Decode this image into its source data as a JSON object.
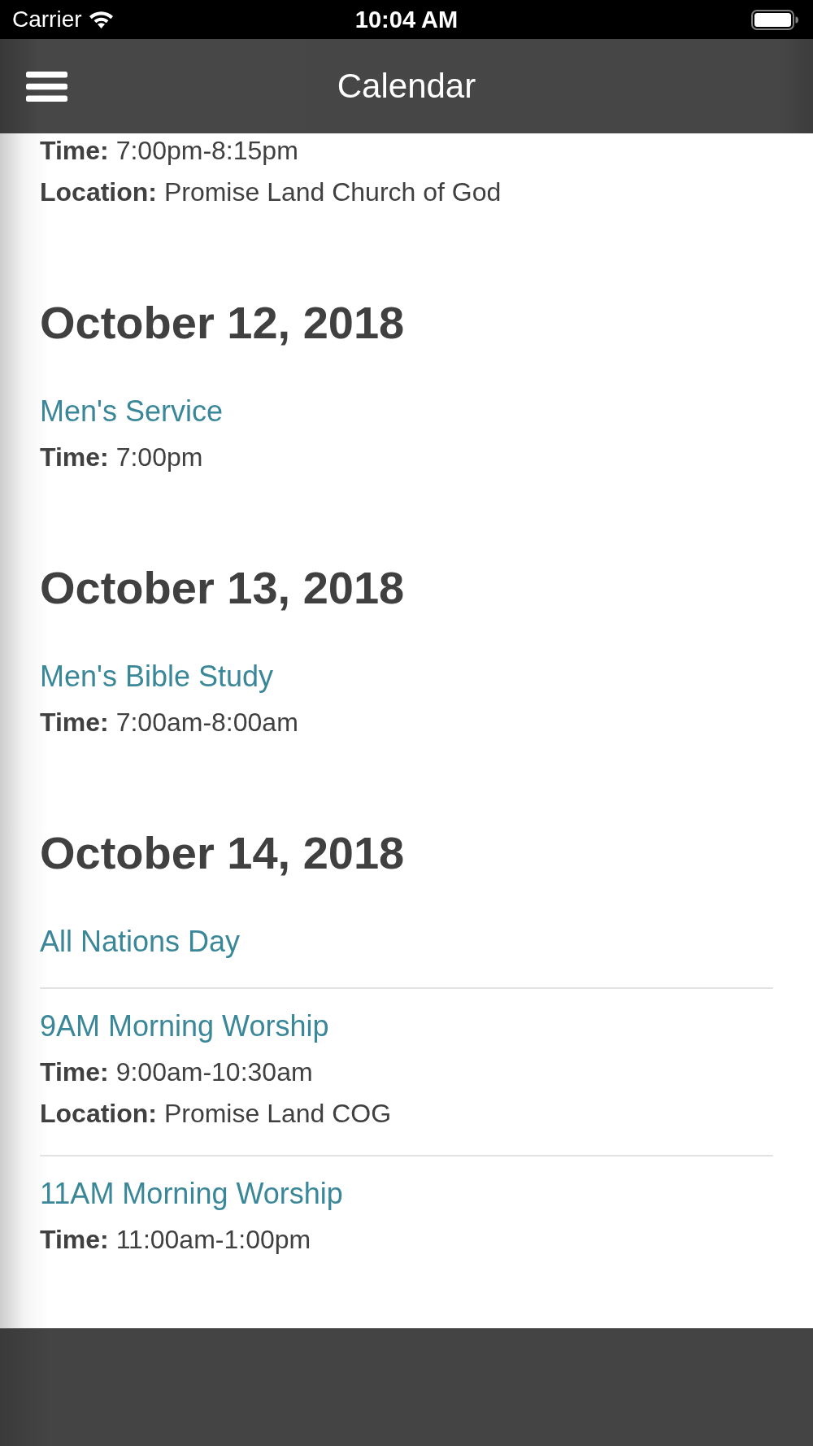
{
  "status_bar": {
    "carrier": "Carrier",
    "time": "10:04 AM"
  },
  "header": {
    "title": "Calendar"
  },
  "sections": [
    {
      "events": [
        {
          "details": [
            "**Time:** 7:00pm-8:15pm",
            "**Location:** Promise Land Church of God"
          ]
        }
      ]
    },
    {
      "date": "October 12, 2018",
      "events": [
        {
          "title": "Men's Service",
          "details": [
            "**Time:** 7:00pm"
          ]
        }
      ]
    },
    {
      "date": "October 13, 2018",
      "events": [
        {
          "title": "Men's Bible Study",
          "details": [
            "**Time:** 7:00am-8:00am"
          ]
        }
      ]
    },
    {
      "date": "October 14, 2018",
      "events": [
        {
          "title": "All Nations Day"
        },
        {
          "title": "9AM Morning Worship",
          "details": [
            "**Time:** 9:00am-10:30am",
            "**Location:** Promise Land COG"
          ]
        },
        {
          "title": "11AM Morning Worship",
          "details": [
            "**Time:** 11:00am-1:00pm"
          ]
        }
      ]
    }
  ]
}
